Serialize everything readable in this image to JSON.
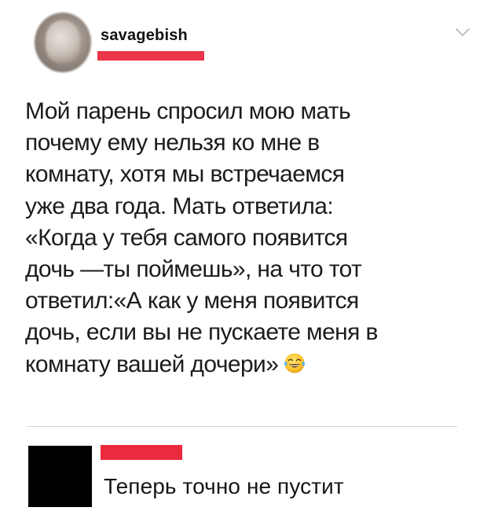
{
  "post": {
    "username": "savagebish",
    "body": "Мой парень спросил мою мать\nпочему ему нельзя ко мне в\nкомнату, хотя мы встречаемся\nуже два года. Мать ответила:\n«Когда у тебя самого появится\nдочь —ты поймешь», на что тот\nответил:«А как у меня появится\nдочь, если вы не пускаете меня в\nкомнату вашей дочери»",
    "trailing_emoji": "face-with-tears-of-joy-icon",
    "menu_icon": "chevron-down-icon"
  },
  "reply": {
    "text": "Теперь точно не пустит"
  },
  "colors": {
    "redaction": "#ec3649",
    "reply_redaction": "#ec2a3d",
    "reply_avatar": "#000000",
    "divider": "#d6d6d6"
  }
}
